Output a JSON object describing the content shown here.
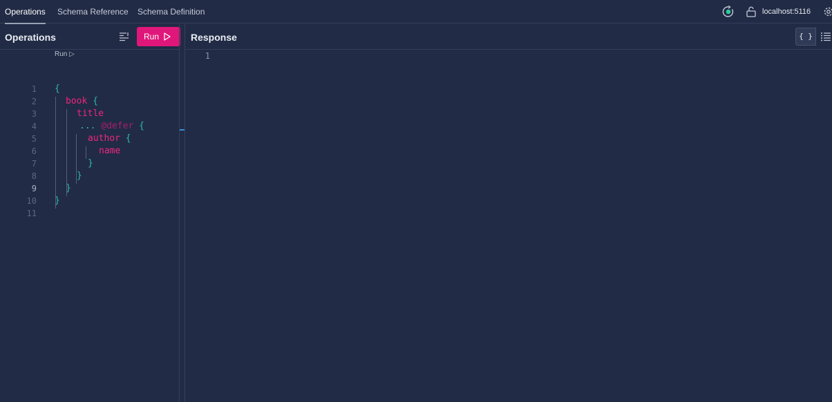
{
  "tabs": [
    {
      "label": "Operations",
      "active": true
    },
    {
      "label": "Schema Reference",
      "active": false
    },
    {
      "label": "Schema Definition",
      "active": false
    }
  ],
  "connection": {
    "host": "localhost:5116",
    "status_icon": "refresh-connected-icon",
    "lock_icon": "unlocked-icon",
    "settings_icon": "gear-icon"
  },
  "operations_panel": {
    "title": "Operations",
    "prettify_icon": "prettify-icon",
    "run_label": "Run",
    "codelens_label": "Run ▷",
    "lines": [
      {
        "n": "1",
        "text": "{"
      },
      {
        "n": "2",
        "text": "book {"
      },
      {
        "n": "3",
        "text": "title"
      },
      {
        "n": "4",
        "text": "... @defer {"
      },
      {
        "n": "5",
        "text": "author {"
      },
      {
        "n": "6",
        "text": "name"
      },
      {
        "n": "7",
        "text": "}"
      },
      {
        "n": "8",
        "text": "}"
      },
      {
        "n": "9",
        "text": "}"
      },
      {
        "n": "10",
        "text": "}"
      },
      {
        "n": "11",
        "text": ""
      }
    ],
    "current_line": "9"
  },
  "response_panel": {
    "title": "Response",
    "json_view_label": "{ }",
    "list_view_icon": "list-view-icon",
    "lines": [
      {
        "n": "1",
        "text": ""
      }
    ]
  },
  "colors": {
    "accent": "#e0177a",
    "background": "#212b45",
    "keyword": "#f0267f",
    "bracket": "#2fb8b0"
  }
}
